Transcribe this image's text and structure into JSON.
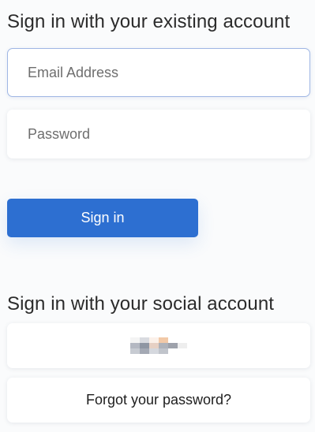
{
  "existing_account": {
    "heading": "Sign in with your existing account",
    "email": {
      "value": "",
      "placeholder": "Email Address"
    },
    "password": {
      "value": "",
      "placeholder": "Password"
    },
    "sign_in_label": "Sign in",
    "sign_in_color": "#2d6fd1"
  },
  "social_account": {
    "heading": "Sign in with your social account",
    "provider_icon": "blurred-provider-logo",
    "forgot_password_label": "Forgot your password?"
  }
}
